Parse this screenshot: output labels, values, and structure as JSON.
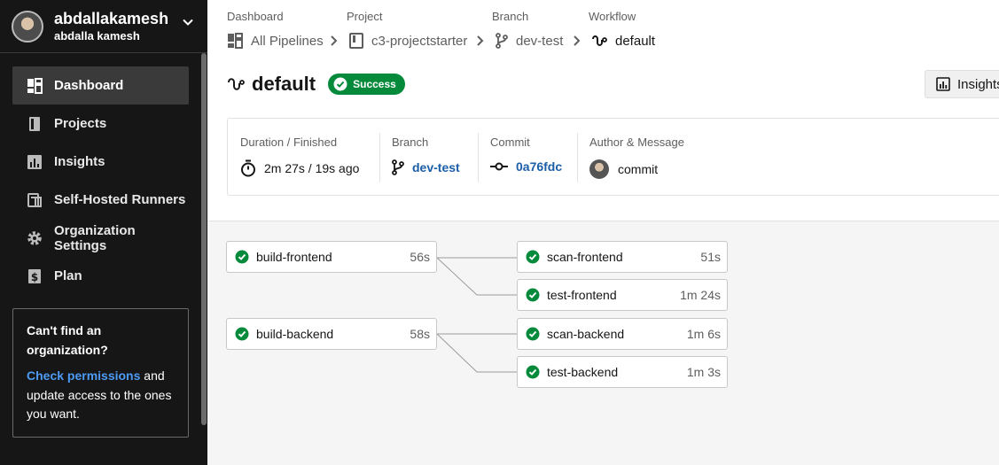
{
  "user": {
    "username": "abdallakamesh",
    "display_name": "abdalla kamesh"
  },
  "nav": [
    {
      "label": "Dashboard",
      "icon": "dashboard-icon",
      "active": true
    },
    {
      "label": "Projects",
      "icon": "book-icon",
      "active": false
    },
    {
      "label": "Insights",
      "icon": "insights-icon",
      "active": false
    },
    {
      "label": "Self-Hosted Runners",
      "icon": "runners-icon",
      "active": false
    },
    {
      "label": "Organization Settings",
      "icon": "gear-icon",
      "active": false
    },
    {
      "label": "Plan",
      "icon": "dollar-icon",
      "active": false
    }
  ],
  "help": {
    "title": "Can't find an organization?",
    "link": "Check permissions",
    "text": " and update access to the ones you want."
  },
  "breadcrumb": {
    "labels": [
      "Dashboard",
      "Project",
      "Branch",
      "Workflow"
    ],
    "dashboard": "All Pipelines",
    "project": "c3-projectstarter",
    "branch": "dev-test",
    "workflow": "default"
  },
  "workflow": {
    "title": "default",
    "status": "Success"
  },
  "insights_button": "Insights",
  "summary": {
    "duration_label": "Duration / Finished",
    "duration_value": "2m 27s / 19s ago",
    "branch_label": "Branch",
    "branch_value": "dev-test",
    "commit_label": "Commit",
    "commit_value": "0a76fdc",
    "author_label": "Author & Message",
    "message": "commit"
  },
  "jobs": {
    "build_frontend": {
      "name": "build-frontend",
      "duration": "56s"
    },
    "scan_frontend": {
      "name": "scan-frontend",
      "duration": "51s"
    },
    "test_frontend": {
      "name": "test-frontend",
      "duration": "1m 24s"
    },
    "build_backend": {
      "name": "build-backend",
      "duration": "58s"
    },
    "scan_backend": {
      "name": "scan-backend",
      "duration": "1m 6s"
    },
    "test_backend": {
      "name": "test-backend",
      "duration": "1m 3s"
    }
  },
  "colors": {
    "success": "#048a3a",
    "link": "#1b5ea8",
    "sidebar_bg": "#161616"
  }
}
